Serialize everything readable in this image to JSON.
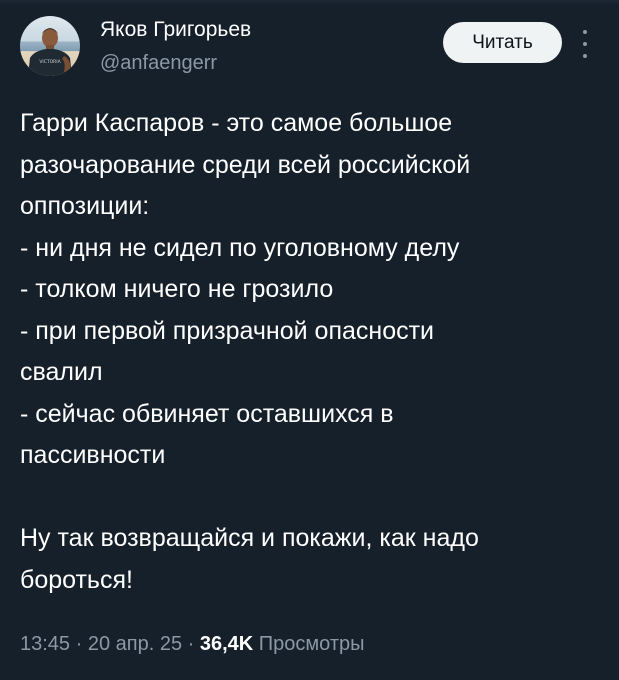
{
  "author": {
    "name": "Яков Григорьев",
    "handle": "@anfaengerr",
    "avatar_shirt_text": "VICTORIA"
  },
  "actions": {
    "follow_label": "Читать",
    "more_icon": "more-vertical-icon"
  },
  "tweet": {
    "lines": [
      "Гарри Каспаров - это самое большое",
      "разочарование среди всей российской",
      "оппозиции:",
      "- ни дня не сидел по уголовному делу",
      "- толком ничего не грозило",
      "- при первой призрачной опасности",
      "свалил",
      "- сейчас обвиняет оставшихся в",
      "пассивности",
      "",
      "Ну так возвращайся и покажи, как надо",
      "бороться!"
    ]
  },
  "meta": {
    "time": "13:45",
    "separator": "·",
    "date": "20 апр. 25",
    "views_count": "36,4K",
    "views_label": "Просмотры"
  },
  "colors": {
    "background": "#15202b",
    "text_primary": "#ffffff",
    "text_secondary": "#8b98a5",
    "button_bg": "#eff3f4",
    "button_text": "#0f1419"
  }
}
